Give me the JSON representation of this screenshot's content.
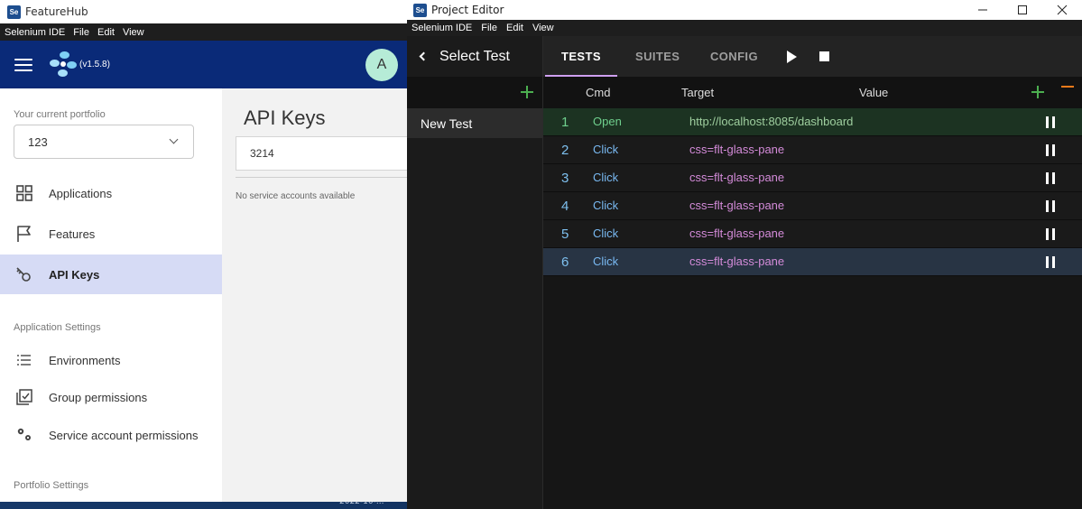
{
  "desktop": {
    "clock": "2022-10-..."
  },
  "featurehub": {
    "window_title": "FeatureHub",
    "menu": [
      "Selenium IDE",
      "File",
      "Edit",
      "View"
    ],
    "version": "(v1.5.8)",
    "avatar_initial": "A",
    "portfolio_label": "Your current portfolio",
    "portfolio_value": "123",
    "nav": [
      {
        "label": "Applications",
        "icon": "grid-icon"
      },
      {
        "label": "Features",
        "icon": "flag-icon"
      },
      {
        "label": "API Keys",
        "icon": "key-icon"
      }
    ],
    "app_settings_label": "Application Settings",
    "app_settings": [
      {
        "label": "Environments",
        "icon": "list-icon"
      },
      {
        "label": "Group permissions",
        "icon": "checkbox-icon"
      },
      {
        "label": "Service account permissions",
        "icon": "gears-icon"
      }
    ],
    "portfolio_settings_label": "Portfolio Settings",
    "content": {
      "title": "API Keys",
      "search_value": "3214",
      "empty_message": "No service accounts available"
    }
  },
  "selenium": {
    "window_title": "Project Editor",
    "menu": [
      "Selenium IDE",
      "File",
      "Edit",
      "View"
    ],
    "select_test_label": "Select Test",
    "tests": [
      "New Test"
    ],
    "tabs": [
      "TESTS",
      "SUITES",
      "CONFIG"
    ],
    "columns": {
      "cmd": "Cmd",
      "target": "Target",
      "value": "Value"
    },
    "commands": [
      {
        "num": "1",
        "cmd": "Open",
        "target": "http://localhost:8085/dashboard",
        "value": ""
      },
      {
        "num": "2",
        "cmd": "Click",
        "target": "css=flt-glass-pane",
        "value": ""
      },
      {
        "num": "3",
        "cmd": "Click",
        "target": "css=flt-glass-pane",
        "value": ""
      },
      {
        "num": "4",
        "cmd": "Click",
        "target": "css=flt-glass-pane",
        "value": ""
      },
      {
        "num": "5",
        "cmd": "Click",
        "target": "css=flt-glass-pane",
        "value": ""
      },
      {
        "num": "6",
        "cmd": "Click",
        "target": "css=flt-glass-pane",
        "value": ""
      }
    ]
  }
}
